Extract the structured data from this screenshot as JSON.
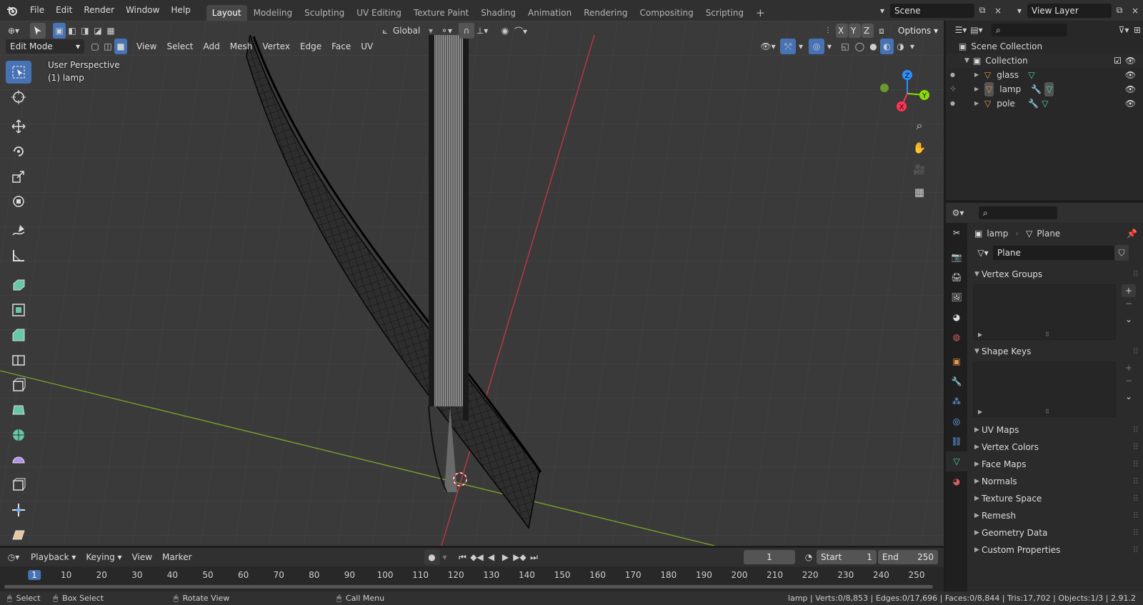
{
  "app": {
    "menus": [
      "File",
      "Edit",
      "Render",
      "Window",
      "Help"
    ],
    "workspaces": [
      "Layout",
      "Modeling",
      "Sculpting",
      "UV Editing",
      "Texture Paint",
      "Shading",
      "Animation",
      "Rendering",
      "Compositing",
      "Scripting"
    ],
    "active_workspace": "Layout",
    "scene_name": "Scene",
    "view_layer_name": "View Layer"
  },
  "viewport": {
    "mode": "Edit Mode",
    "header_menus": [
      "View",
      "Select",
      "Add",
      "Mesh",
      "Vertex",
      "Edge",
      "Face",
      "UV"
    ],
    "transform_orientation": "Global",
    "axis_x": "X",
    "axis_y": "Y",
    "axis_z": "Z",
    "options_label": "Options",
    "perspective_label": "User Perspective",
    "object_label": "(1) lamp",
    "gizmo_x": "X",
    "gizmo_y": "Y",
    "gizmo_z": "Z"
  },
  "outliner": {
    "scene_collection": "Scene Collection",
    "collection": "Collection",
    "objects": [
      "glass",
      "lamp",
      "pole"
    ]
  },
  "properties": {
    "object_name": "lamp",
    "data_name": "Plane",
    "data_field": "Plane",
    "panels_open": [
      "Vertex Groups",
      "Shape Keys"
    ],
    "panels_closed": [
      "UV Maps",
      "Vertex Colors",
      "Face Maps",
      "Normals",
      "Texture Space",
      "Remesh",
      "Geometry Data",
      "Custom Properties"
    ]
  },
  "timeline": {
    "menus": [
      "Playback",
      "Keying",
      "View",
      "Marker"
    ],
    "current_frame": "1",
    "start_label": "Start",
    "start_value": "1",
    "end_label": "End",
    "end_value": "250",
    "ruler": [
      "1",
      "10",
      "20",
      "30",
      "40",
      "50",
      "60",
      "70",
      "80",
      "90",
      "100",
      "110",
      "120",
      "130",
      "140",
      "150",
      "160",
      "170",
      "180",
      "190",
      "200",
      "210",
      "220",
      "230",
      "240",
      "250"
    ]
  },
  "statusbar": {
    "select": "Select",
    "box_select": "Box Select",
    "rotate_view": "Rotate View",
    "call_menu": "Call Menu",
    "stats": "lamp | Verts:0/8,853 | Edges:0/17,696 | Faces:0/8,844 | Tris:17,702 | Objects:1/3 | 2.91.2"
  },
  "colors": {
    "accent": "#4772b3",
    "x_axis": "#ff3352",
    "y_axis": "#8bdc00",
    "z_axis": "#2890ff",
    "mesh_icon": "#e69a4a",
    "data_icon": "#4fd6a4"
  }
}
